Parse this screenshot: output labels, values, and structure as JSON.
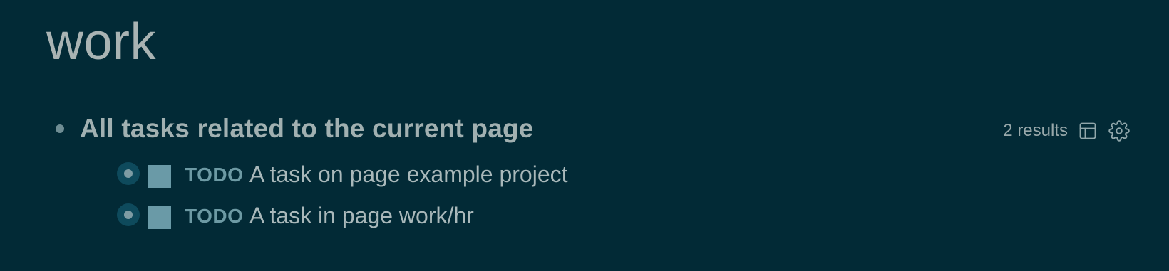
{
  "page": {
    "title": "work"
  },
  "query": {
    "title": "All tasks related to the current page",
    "results_label": "2 results",
    "icons": [
      "table-icon",
      "gear-icon"
    ]
  },
  "tasks": [
    {
      "marker": "TODO",
      "text": "A task on page example project"
    },
    {
      "marker": "TODO",
      "text": "A task in page work/hr"
    }
  ],
  "colors": {
    "background": "#022a36",
    "checkbox": "#6a9aa7",
    "marker": "#6d9aa4",
    "bullet_ring": "#0e4a5c"
  }
}
